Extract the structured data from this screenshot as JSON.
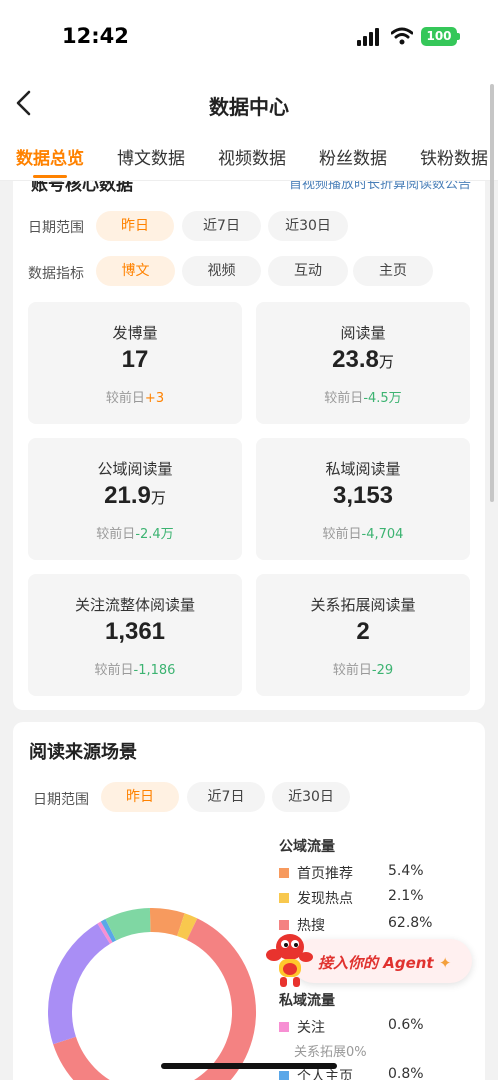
{
  "status_bar": {
    "time": "12:42",
    "battery": "100"
  },
  "nav": {
    "title": "数据中心"
  },
  "tabs": [
    {
      "label": "数据总览",
      "active": true
    },
    {
      "label": "博文数据",
      "active": false
    },
    {
      "label": "视频数据",
      "active": false
    },
    {
      "label": "粉丝数据",
      "active": false
    },
    {
      "label": "铁粉数据",
      "active": false
    }
  ],
  "overview": {
    "header": "账号核心数据",
    "header_link": "首视频播放时长折算阅读数公告",
    "date_range_label": "日期范围",
    "date_options": [
      "昨日",
      "近7日",
      "近30日"
    ],
    "metric_label": "数据指标",
    "metric_options": [
      "博文",
      "视频",
      "互动",
      "主页"
    ],
    "cmp_prefix": "较前日",
    "metrics": [
      {
        "title": "发博量",
        "value": "17",
        "unit": "",
        "delta": "+3",
        "dir": "up"
      },
      {
        "title": "阅读量",
        "value": "23.8",
        "unit": "万",
        "delta": "-4.5万",
        "dir": "down"
      },
      {
        "title": "公域阅读量",
        "value": "21.9",
        "unit": "万",
        "delta": "-2.4万",
        "dir": "down"
      },
      {
        "title": "私域阅读量",
        "value": "3,153",
        "unit": "",
        "delta": "-4,704",
        "dir": "down"
      },
      {
        "title": "关注流整体阅读量",
        "value": "1,361",
        "unit": "",
        "delta": "-1,186",
        "dir": "down"
      },
      {
        "title": "关系拓展阅读量",
        "value": "2",
        "unit": "",
        "delta": "-29",
        "dir": "down"
      }
    ]
  },
  "source": {
    "title": "阅读来源场景",
    "date_range_label": "日期范围",
    "date_options": [
      "昨日",
      "近7日",
      "近30日"
    ],
    "public_group": "公域流量",
    "private_group": "私域流量",
    "public_items": [
      {
        "label": "首页推荐",
        "pct": "5.4%",
        "color": "#f79a5e"
      },
      {
        "label": "发现热点",
        "pct": "2.1%",
        "color": "#f8c84e"
      },
      {
        "label": "热搜",
        "pct": "62.8%",
        "color": "#f48282"
      }
    ],
    "private_items": [
      {
        "label": "关注",
        "pct": "0.6%",
        "color": "#f78fd3"
      },
      {
        "label": "个人主页",
        "pct": "0.8%",
        "color": "#5aa7e8"
      }
    ],
    "private_sub": "关系拓展0%"
  },
  "agent": {
    "label": "接入你的 Agent"
  },
  "colors": {
    "accent": "#ff8200",
    "decrease": "#3cb371",
    "donut_purple": "#a98ef5",
    "donut_green": "#7fd7a3"
  }
}
